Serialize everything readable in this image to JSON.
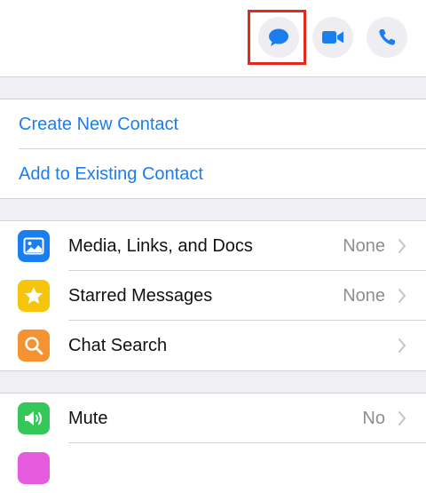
{
  "header": {
    "message_icon": "chat-bubble-icon",
    "video_icon": "video-camera-icon",
    "call_icon": "phone-icon"
  },
  "contact_actions": {
    "create_new": "Create New Contact",
    "add_existing": "Add to Existing Contact"
  },
  "info_rows": [
    {
      "label": "Media, Links, and Docs",
      "value": "None",
      "icon": "photo-icon",
      "color": "#1a7ef0"
    },
    {
      "label": "Starred Messages",
      "value": "None",
      "icon": "star-icon",
      "color": "#f7c40c"
    },
    {
      "label": "Chat Search",
      "value": "",
      "icon": "magnifier-icon",
      "color": "#f59232"
    }
  ],
  "settings_rows": [
    {
      "label": "Mute",
      "value": "No",
      "icon": "speaker-icon",
      "color": "#34c759"
    }
  ],
  "colors": {
    "accent": "#1a7ef0",
    "highlight": "#e4281c",
    "next_row_icon": "#e45be0"
  }
}
